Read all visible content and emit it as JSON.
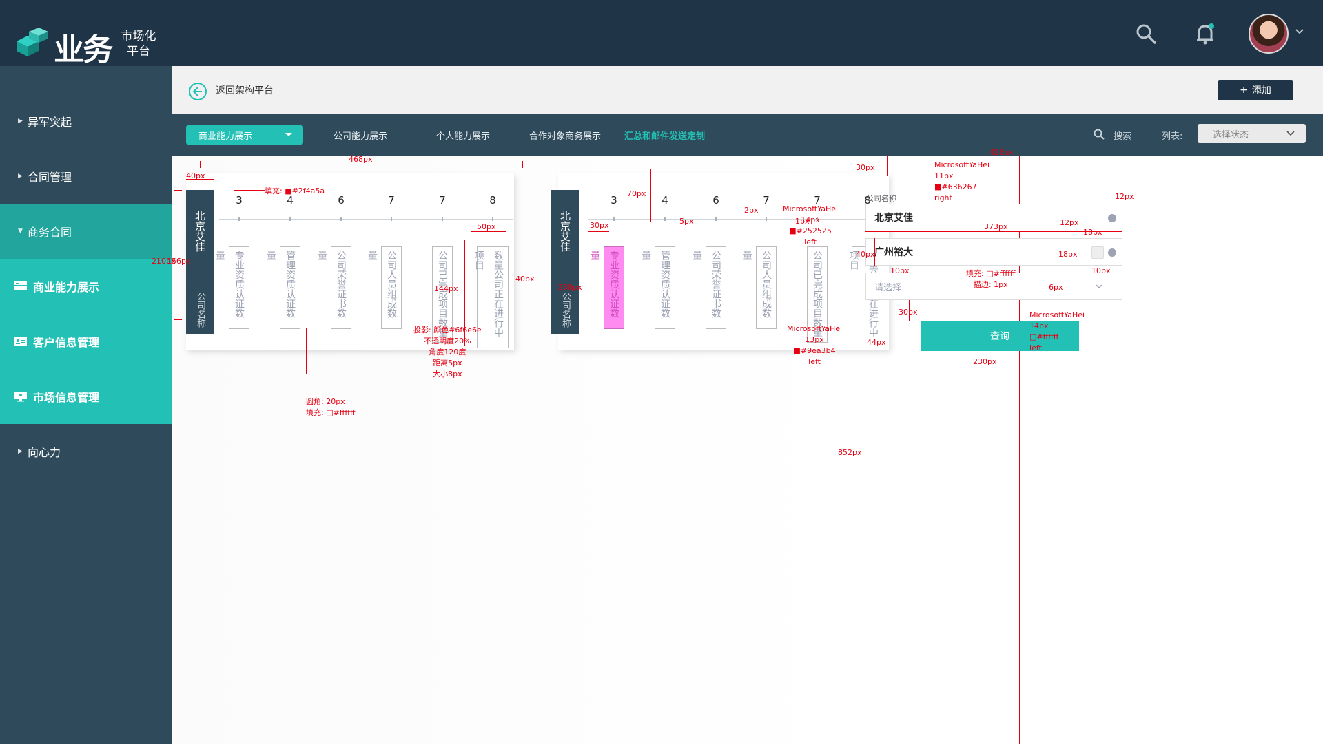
{
  "topbar": {
    "logo_main": "业务",
    "logo_sub_line1": "市场化",
    "logo_sub_line2": "平台",
    "icons": [
      "search-icon",
      "bell-icon",
      "avatar",
      "chevron-down-icon"
    ]
  },
  "sidebar": {
    "items": [
      {
        "label": "异军突起",
        "type": "group"
      },
      {
        "label": "合同管理",
        "type": "group"
      },
      {
        "label": "商务合同",
        "type": "group-open"
      },
      {
        "label": "商业能力展示",
        "type": "sub"
      },
      {
        "label": "客户信息管理",
        "type": "sub"
      },
      {
        "label": "市场信息管理",
        "type": "sub"
      },
      {
        "label": "向心力",
        "type": "group"
      }
    ]
  },
  "header": {
    "back_label": "返回架构平台",
    "add_label": "添加"
  },
  "tabs": {
    "select_label": "商业能力展示",
    "items": [
      "公司能力展示",
      "个人能力展示",
      "合作对象商务展示"
    ],
    "highlight": "汇总和邮件发送定制",
    "search_label": "搜索",
    "list_label": "列表:",
    "status_placeholder": "选择状态"
  },
  "cards": [
    {
      "company": "北京艾佳",
      "company_label": "公司名称",
      "stats": [
        {
          "value": "3",
          "label": "专业资质认证数量"
        },
        {
          "value": "4",
          "label": "管理资质认证数量"
        },
        {
          "value": "6",
          "label": "公司荣誉证书数量"
        },
        {
          "value": "7",
          "label": "公司人员组成数量"
        },
        {
          "value": "7",
          "label": "公司已完成项目数量"
        },
        {
          "value": "8",
          "label": "数量公司正在进行中项目"
        }
      ]
    },
    {
      "company": "北京艾佳",
      "company_label": "公司名称",
      "stats": [
        {
          "value": "3",
          "label": "专业资质认证数量",
          "highlight": true
        },
        {
          "value": "4",
          "label": "管理资质认证数量"
        },
        {
          "value": "6",
          "label": "公司荣誉证书数量"
        },
        {
          "value": "7",
          "label": "公司人员组成数量"
        },
        {
          "value": "7",
          "label": "公司已完成项目数量"
        },
        {
          "value": "8",
          "label": "数量公司正在进行中项目"
        }
      ]
    }
  ],
  "form": {
    "label": "公司名称",
    "field1": "北京艾佳",
    "field2": "广州裕大",
    "field3_placeholder": "请选择",
    "query_label": "查询"
  },
  "annotations": {
    "w468": "468px",
    "w40": "40px",
    "fill_color": "填充: ■#2f4a5a",
    "h210": "210px",
    "h156": "156px",
    "w50": "50px",
    "h144": "144px",
    "shadow": [
      "投影: 颜色#6f6e6e",
      "不透明度20%",
      "角度120度",
      "距离5px",
      "大小8px"
    ],
    "radius": [
      "圆角: 20px",
      "填充: □#ffffff"
    ],
    "gap40": "40px",
    "h70": "70px",
    "w30": "30px",
    "h230": "230px",
    "p5": "5px",
    "p2": "2px",
    "p1": "1px",
    "w428": "428px",
    "h30a": "30px",
    "font_right": [
      "MicrosoftYaHei",
      "11px",
      "■#636267",
      "right"
    ],
    "p12a": "12px",
    "p12b": "12px",
    "w373": "373px",
    "p18a": "18px",
    "p18b": "18px",
    "font_main": [
      "MicrosoftYaHei",
      "14px",
      "■#252525",
      "left"
    ],
    "h40": "40px",
    "p10a": "10px",
    "p10b": "10px",
    "fill_border": [
      "填充: □#ffffff",
      "描边: 1px"
    ],
    "p6": "6px",
    "font_ph": [
      "MicrosoftYaHei",
      "13px",
      "■#9ea3b4",
      "left"
    ],
    "h30b": "30px",
    "h44": "44px",
    "font_btn": [
      "MicrosoftYaHei",
      "14px",
      "□#ffffff",
      "left"
    ],
    "w230": "230px",
    "h852": "852px"
  }
}
